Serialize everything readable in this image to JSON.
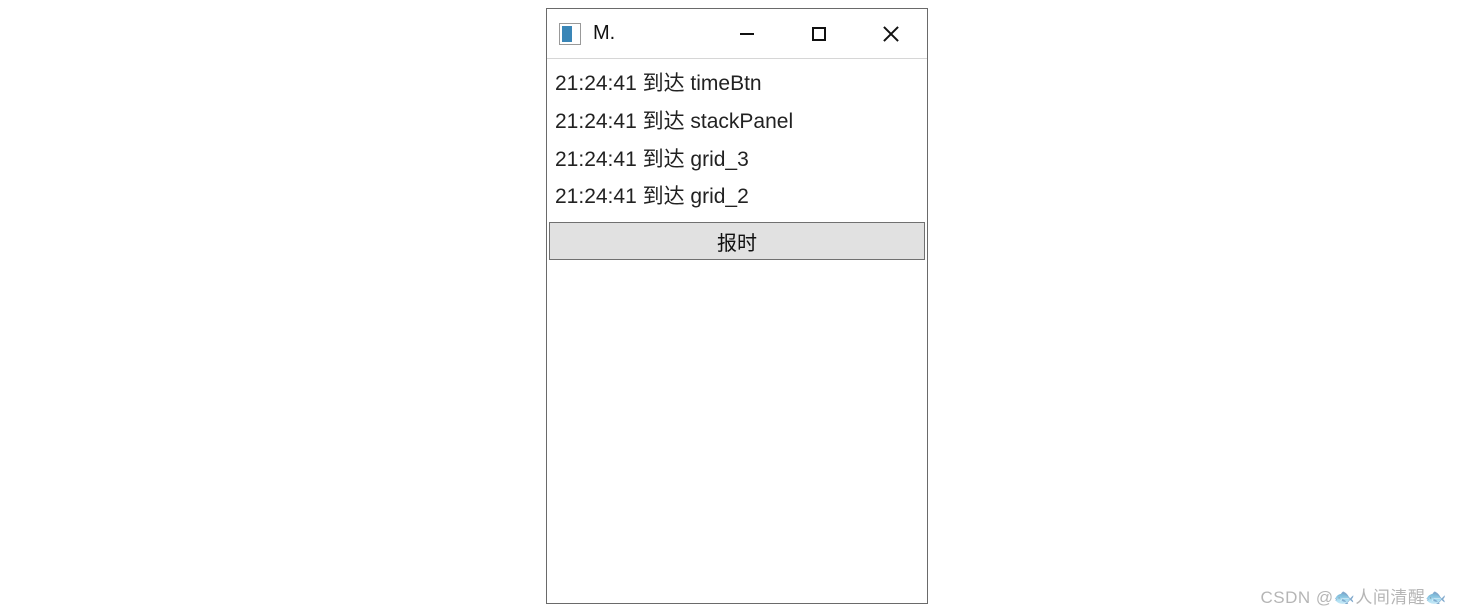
{
  "window": {
    "title": "M."
  },
  "log": {
    "items": [
      "21:24:41 到达 timeBtn",
      "21:24:41 到达 stackPanel",
      "21:24:41 到达 grid_3",
      "21:24:41 到达 grid_2"
    ]
  },
  "button": {
    "label": "报时"
  },
  "watermark": "CSDN @🐟人间清醒🐟"
}
